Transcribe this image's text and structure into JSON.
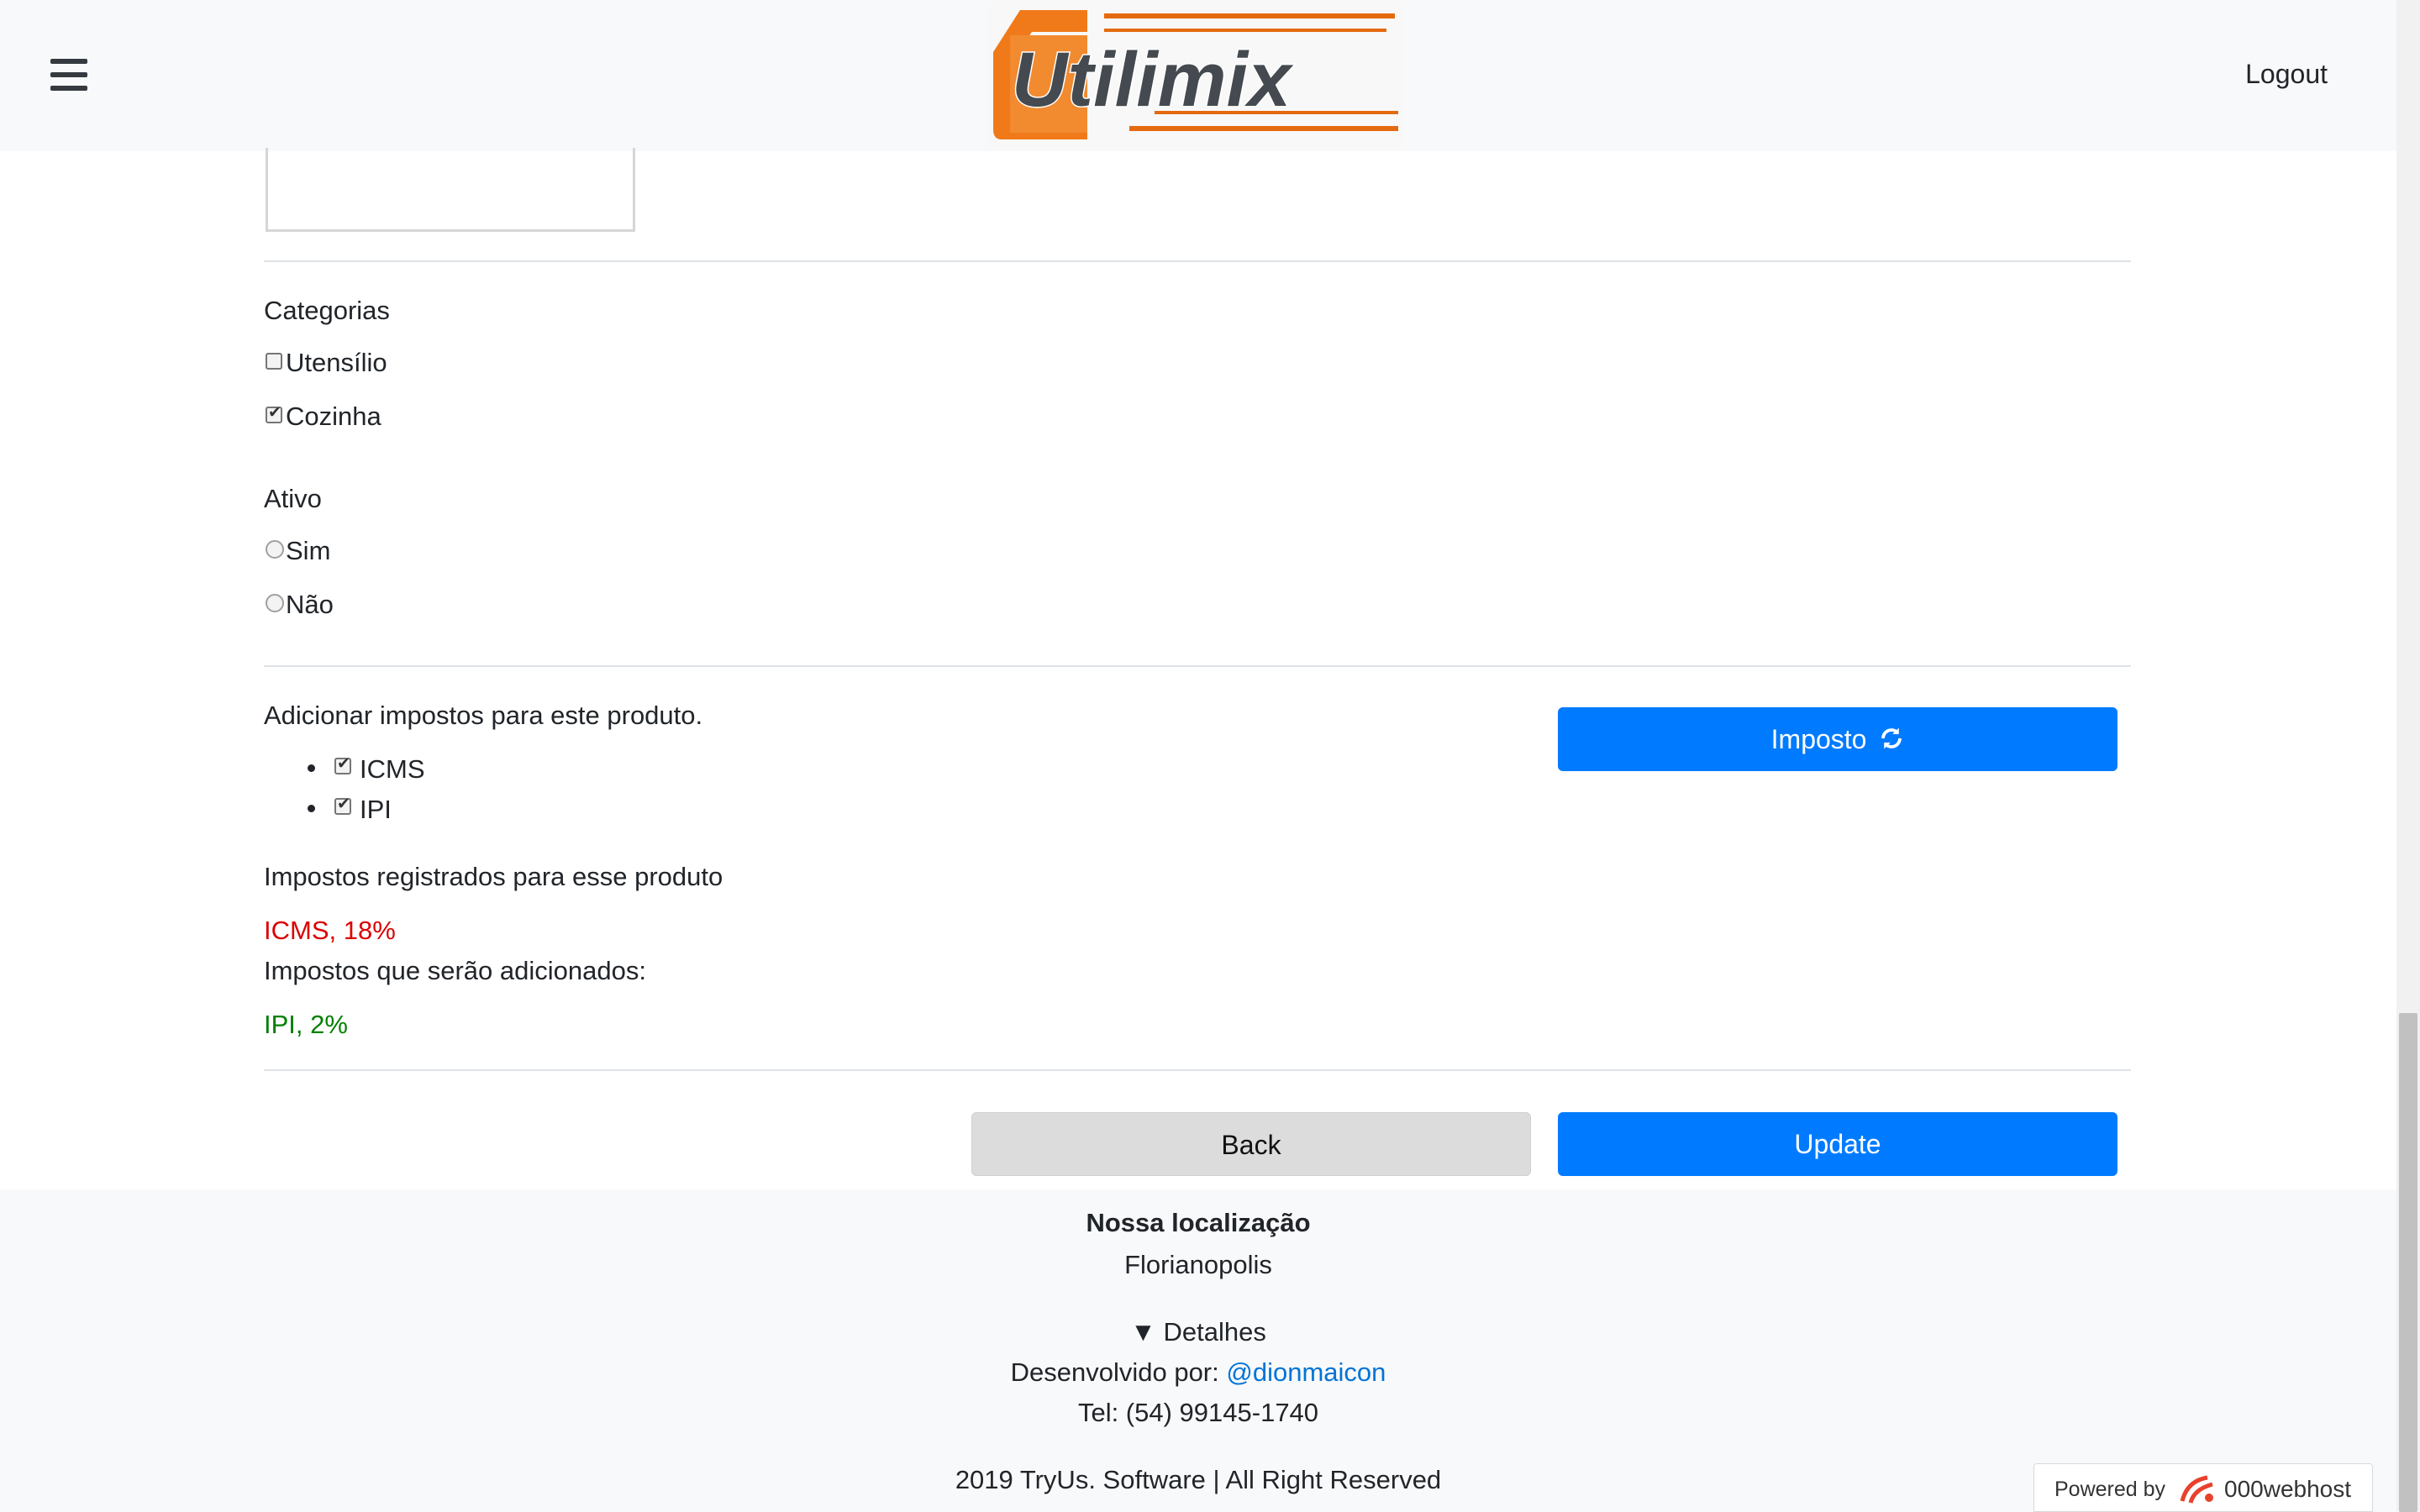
{
  "header": {
    "logo_text": "Utilimix",
    "logout_label": "Logout"
  },
  "form": {
    "categories": {
      "title": "Categorias",
      "items": [
        {
          "label": "Utensílio",
          "checked": false
        },
        {
          "label": "Cozinha",
          "checked": true
        }
      ]
    },
    "active": {
      "title": "Ativo",
      "options": [
        {
          "label": "Sim",
          "selected": false
        },
        {
          "label": "Não",
          "selected": false
        }
      ]
    },
    "taxes": {
      "add_title": "Adicionar impostos para este produto.",
      "items": [
        {
          "label": "ICMS",
          "checked": true
        },
        {
          "label": "IPI",
          "checked": true
        }
      ],
      "imposto_button": "Imposto",
      "registered_title": "Impostos registrados para esse produto",
      "registered_value": "ICMS, 18%",
      "to_add_title": "Impostos que serão adicionados:",
      "to_add_value": "IPI, 2%"
    },
    "back_label": "Back",
    "update_label": "Update"
  },
  "footer": {
    "location_title": "Nossa localização",
    "location_city": "Florianopolis",
    "details_label": "Detalhes",
    "dev_prefix": "Desenvolvido por:",
    "dev_handle": "@dionmaicon",
    "phone": "Tel: (54) 99145-1740",
    "copyright": "2019 TryUs. Software | All Right Reserved"
  },
  "badge": {
    "prefix": "Powered by",
    "brand": "000webhost"
  },
  "colors": {
    "primary": "#007bff",
    "error": "#dc0000",
    "success": "#008000",
    "logo_orange": "#f07a1a"
  }
}
